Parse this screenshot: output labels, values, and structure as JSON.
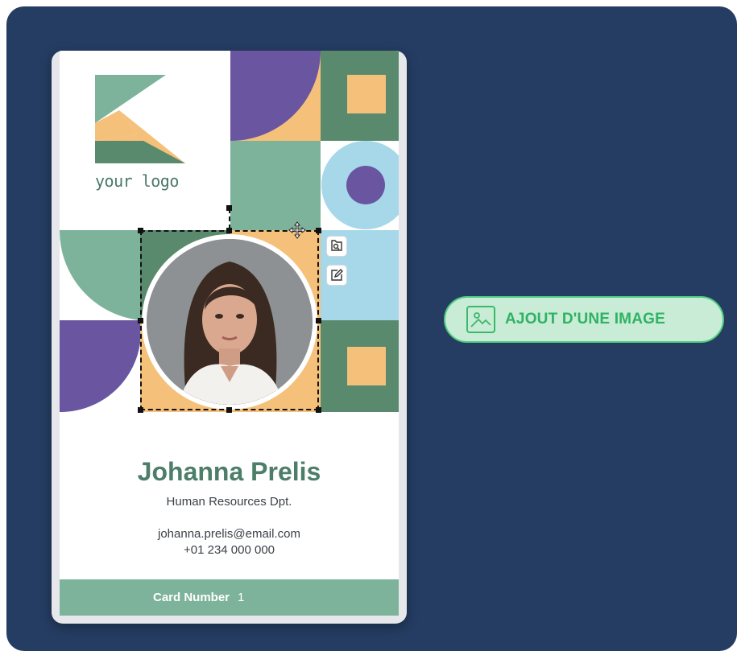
{
  "card": {
    "logo_text": "your logo",
    "name": "Johanna Prelis",
    "department": "Human Resources Dpt.",
    "email": "johanna.prelis@email.com",
    "phone": "+01 234 000 000",
    "footer_label": "Card Number",
    "footer_value": "1",
    "colors": {
      "green": "#7db39a",
      "dark_green": "#5a8a6e",
      "purple": "#6a55a0",
      "orange": "#f5c07a",
      "light_blue": "#a7d8e9",
      "name_text": "#4c7e69"
    }
  },
  "photo_toolbar": {
    "replace_icon": "replace-image-icon",
    "edit_icon": "edit-icon",
    "move_icon": "move-icon"
  },
  "action_button": {
    "label": "AJOUT D'UNE IMAGE",
    "icon": "image-icon",
    "accent": "#2fb264"
  },
  "panel": {
    "background": "#253d63"
  }
}
